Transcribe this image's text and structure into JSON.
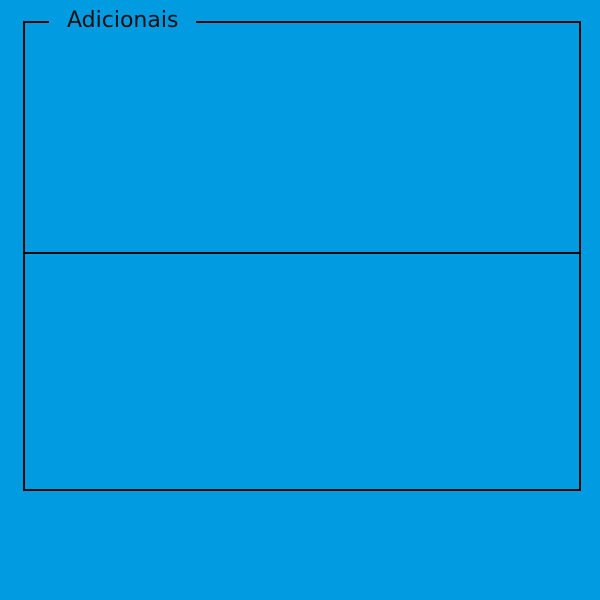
{
  "groupbox": {
    "legend": "Adicionais"
  },
  "colors": {
    "background": "#009be1",
    "border": "#0a0a0a",
    "text": "#111111"
  }
}
